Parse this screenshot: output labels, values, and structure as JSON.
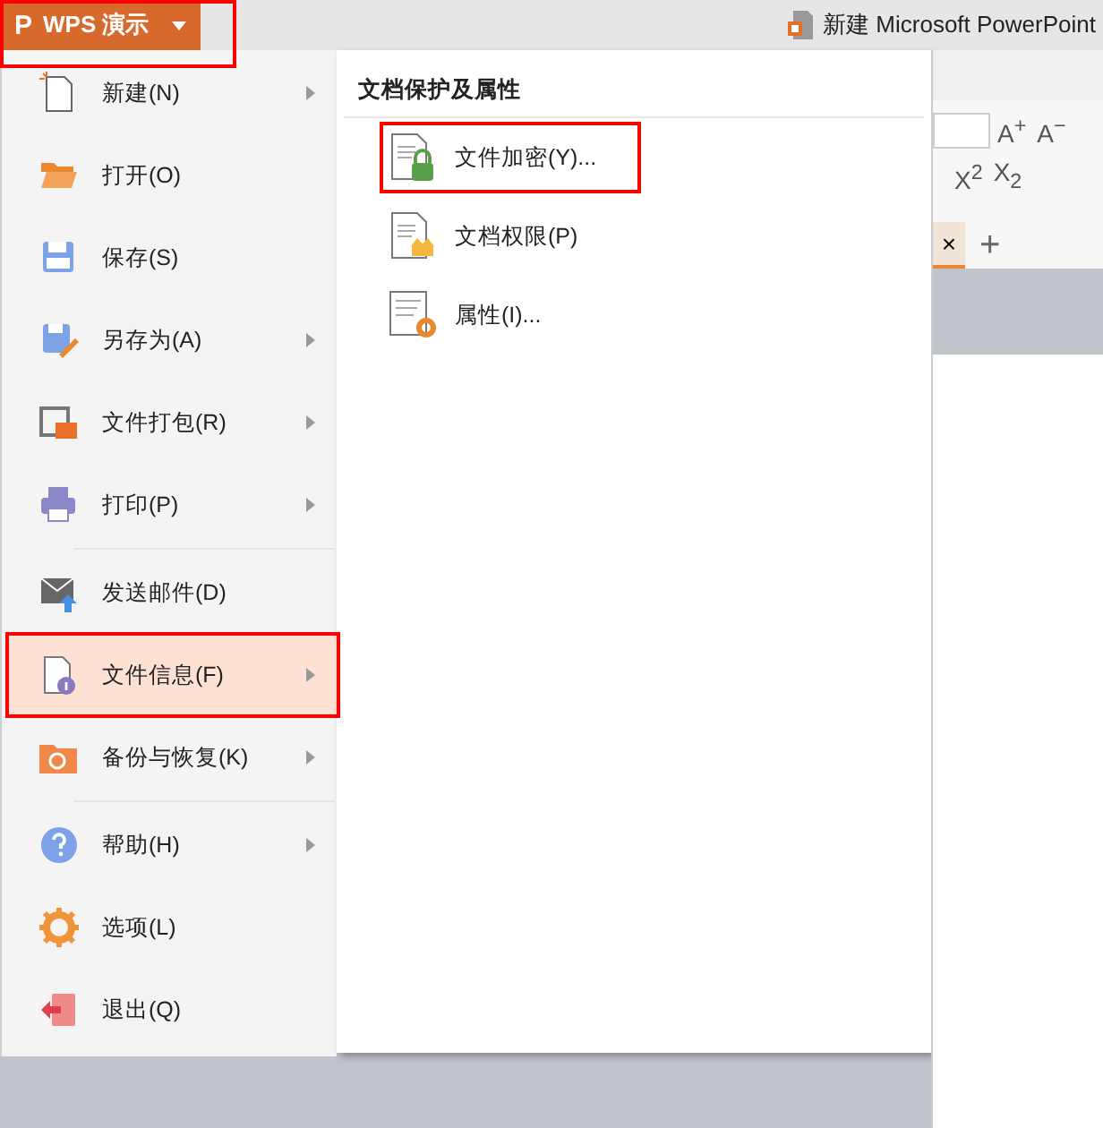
{
  "app_button": {
    "label": "WPS 演示",
    "logo": "P",
    "highlighted": true
  },
  "window": {
    "title": "新建 Microsoft PowerPoint"
  },
  "ribbon": {
    "font_buttons": [
      "A$^{+}$",
      "A$^{−}$",
      "X$^{2}$",
      "X$_{2}$"
    ],
    "tab_close": "×",
    "new_tab": "+"
  },
  "menu": {
    "items": [
      {
        "label": "新建(N)",
        "submenu": true,
        "selected": false,
        "divider_before": false
      },
      {
        "label": "打开(O)",
        "submenu": false,
        "selected": false,
        "divider_before": false
      },
      {
        "label": "保存(S)",
        "submenu": false,
        "selected": false,
        "divider_before": false
      },
      {
        "label": "另存为(A)",
        "submenu": true,
        "selected": false,
        "divider_before": false
      },
      {
        "label": "文件打包(R)",
        "submenu": true,
        "selected": false,
        "divider_before": false
      },
      {
        "label": "打印(P)",
        "submenu": true,
        "selected": false,
        "divider_before": false
      },
      {
        "label": "发送邮件(D)",
        "submenu": false,
        "selected": false,
        "divider_before": true
      },
      {
        "label": "文件信息(F)",
        "submenu": true,
        "selected": true,
        "divider_before": false,
        "highlighted": true
      },
      {
        "label": "备份与恢复(K)",
        "submenu": true,
        "selected": false,
        "divider_before": false
      },
      {
        "label": "帮助(H)",
        "submenu": true,
        "selected": false,
        "divider_before": true
      },
      {
        "label": "选项(L)",
        "submenu": false,
        "selected": false,
        "divider_before": false
      },
      {
        "label": "退出(Q)",
        "submenu": false,
        "selected": false,
        "divider_before": false
      }
    ]
  },
  "submenu": {
    "heading": "文档保护及属性",
    "items": [
      {
        "label": "文件加密(Y)...",
        "highlighted": true
      },
      {
        "label": "文档权限(P)",
        "highlighted": false
      },
      {
        "label": "属性(I)...",
        "highlighted": false
      }
    ]
  }
}
